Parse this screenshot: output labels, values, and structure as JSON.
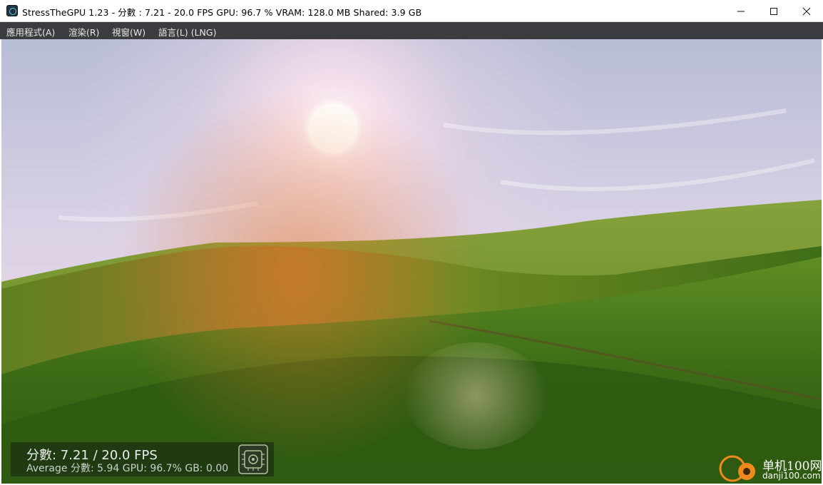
{
  "window": {
    "title": "StressTheGPU 1.23 - 分數 : 7.21 - 20.0 FPS GPU: 96.7 %  VRAM: 128.0 MB Shared: 3.9 GB"
  },
  "menu": {
    "items": [
      "應用程式(A)",
      "渲染(R)",
      "視窗(W)",
      "語言(L) (LNG)"
    ]
  },
  "hud": {
    "score_line": "分數: 7.21   / 20.0 FPS",
    "average_line": "Average 分數: 5.94 GPU: 96.7% GB: 0.00",
    "logo_icon": "gpu-chip-icon"
  },
  "watermark": {
    "name": "单机100网",
    "url": "danji100.com"
  },
  "colors": {
    "menubar": "#3a3c40",
    "grass_dark": "#2f5a12",
    "grass_light": "#6e9c2c",
    "sky_top": "#b9bfd6"
  }
}
